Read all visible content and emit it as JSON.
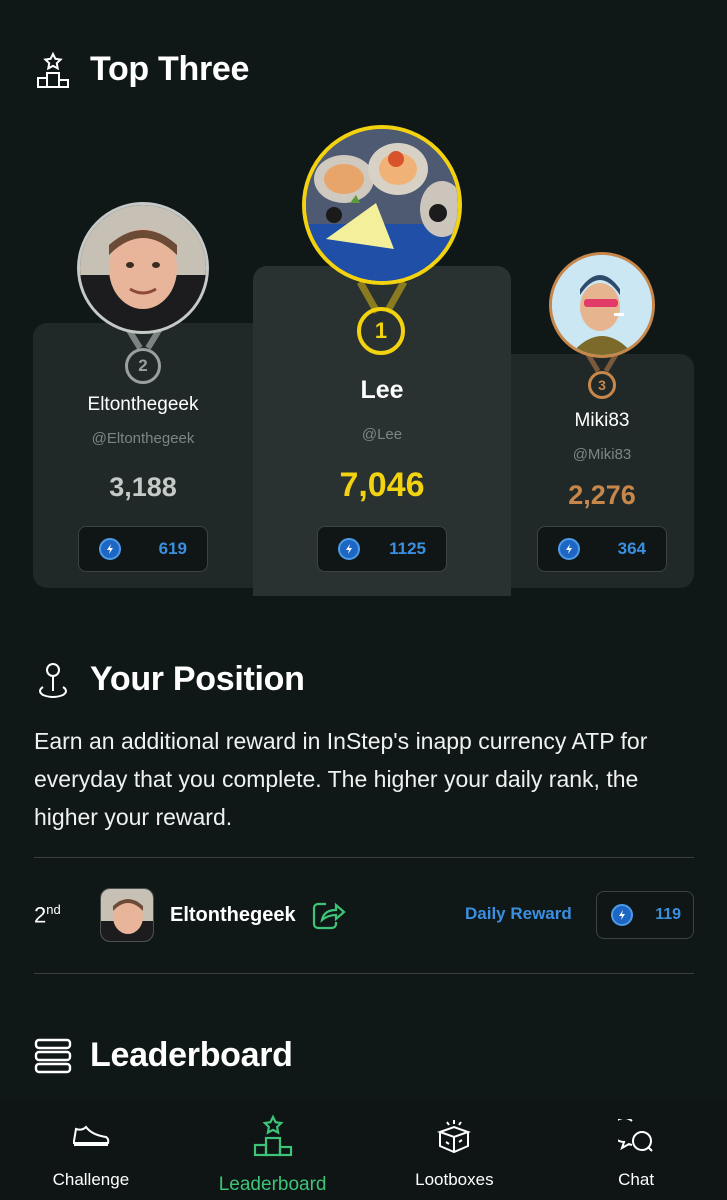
{
  "top_three": {
    "title": "Top Three",
    "players": [
      {
        "rank": "2",
        "name": "Eltonthegeek",
        "handle": "@Eltonthegeek",
        "score": "3,188",
        "reward": "619",
        "color": "#c5c9c8"
      },
      {
        "rank": "1",
        "name": "Lee",
        "handle": "@Lee",
        "score": "7,046",
        "reward": "1125",
        "color": "#f3d20f"
      },
      {
        "rank": "3",
        "name": "Miki83",
        "handle": "@Miki83",
        "score": "2,276",
        "reward": "364",
        "color": "#c8874a"
      }
    ]
  },
  "your_position": {
    "title": "Your Position",
    "description": "Earn an additional reward in InStep's inapp currency ATP for everyday that you complete. The higher your daily rank, the higher your reward.",
    "rank": "2",
    "rank_suffix": "nd",
    "name": "Eltonthegeek",
    "daily_reward_label": "Daily Reward",
    "reward": "119"
  },
  "leaderboard": {
    "title": "Leaderboard"
  },
  "nav": {
    "items": [
      {
        "label": "Challenge",
        "icon": "sneaker-icon"
      },
      {
        "label": "Leaderboard",
        "icon": "podium-icon",
        "active": true
      },
      {
        "label": "Lootboxes",
        "icon": "lootbox-icon"
      },
      {
        "label": "Chat",
        "icon": "chat-icon"
      }
    ]
  },
  "colors": {
    "accent_green": "#3ec478",
    "atp_blue": "#3b8fe0",
    "gold": "#f3d20f",
    "silver": "#c5c9c8",
    "bronze": "#c8874a"
  }
}
